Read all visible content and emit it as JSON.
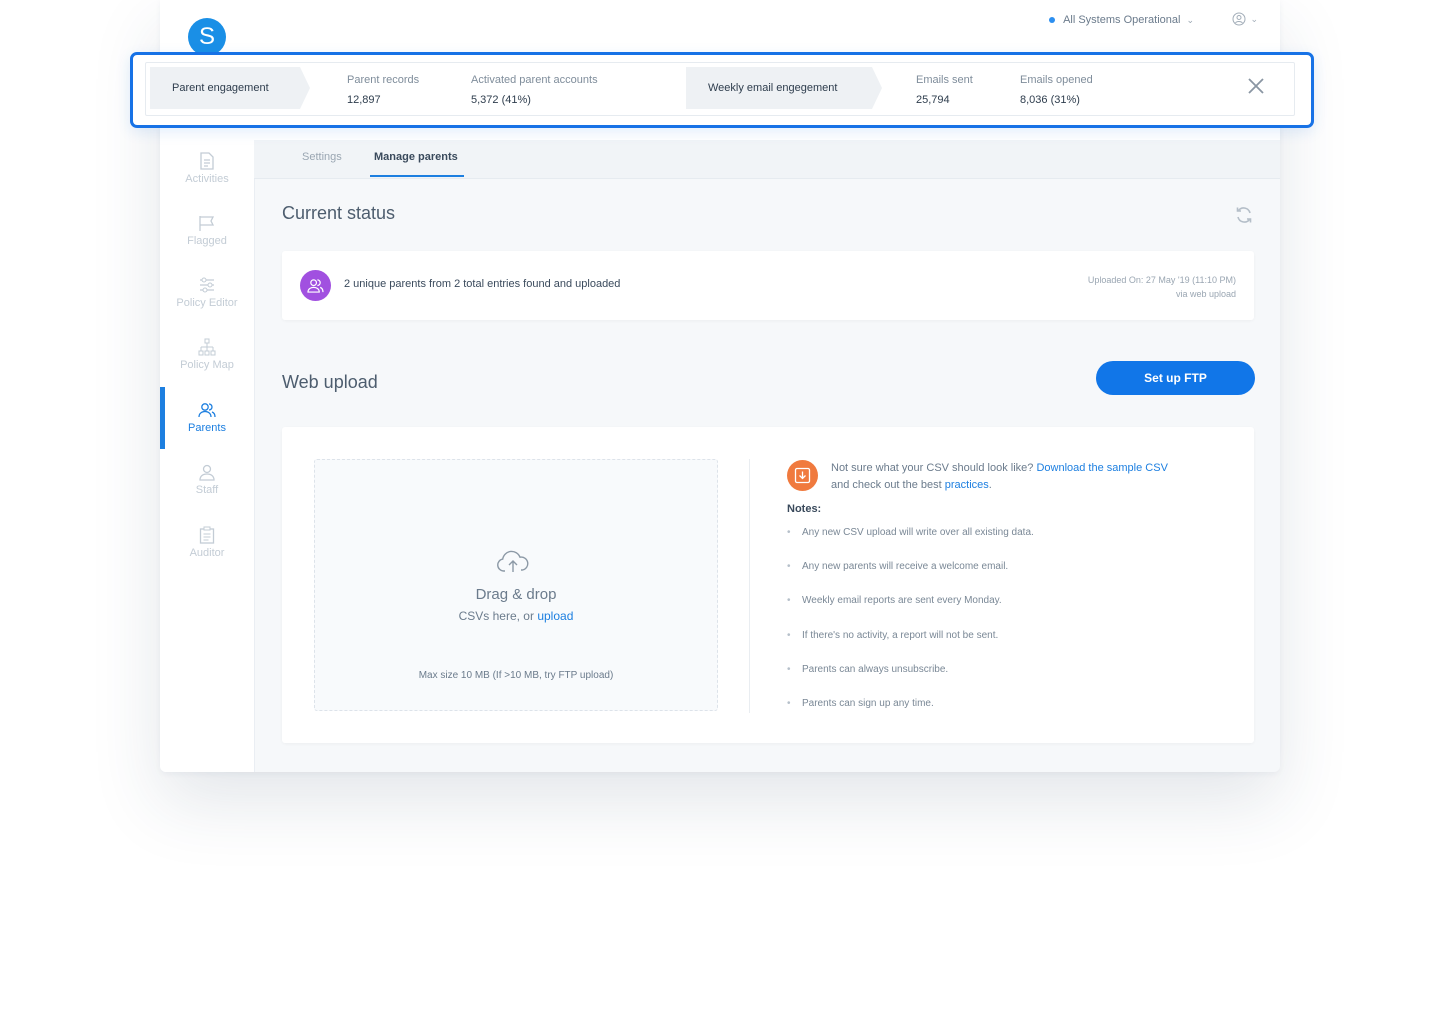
{
  "app": {
    "logo_letter": "S",
    "status": "All Systems Operational"
  },
  "sidebar": {
    "items": [
      {
        "label": "Activities",
        "icon": "document-icon"
      },
      {
        "label": "Flagged",
        "icon": "flag-icon"
      },
      {
        "label": "Policy Editor",
        "icon": "sliders-icon"
      },
      {
        "label": "Policy Map",
        "icon": "hierarchy-icon"
      },
      {
        "label": "Parents",
        "icon": "users-icon",
        "active": true
      },
      {
        "label": "Staff",
        "icon": "user-icon"
      },
      {
        "label": "Auditor",
        "icon": "clipboard-icon"
      }
    ]
  },
  "tabs": [
    {
      "label": "Settings"
    },
    {
      "label": "Manage parents",
      "active": true
    }
  ],
  "current_status": {
    "title": "Current status",
    "message": "2 unique parents from 2 total entries found and uploaded",
    "uploaded_on": "Uploaded On: 27 May '19 (11:10 PM)",
    "via": "via web upload"
  },
  "web_upload": {
    "title": "Web upload",
    "ftp_button": "Set up FTP",
    "drop_title": "Drag & drop",
    "drop_sub_prefix": "CSVs here, or",
    "drop_sub_link": "upload",
    "max_size": "Max size 10 MB (If >10 MB, try FTP upload)",
    "hint_line1": "Not sure what your CSV should look like?",
    "hint_link1": "Download the sample CSV",
    "hint_line2": "and check out the best",
    "hint_link2": "practices",
    "hint_end": ".",
    "notes_label": "Notes:",
    "notes": [
      "Any new CSV upload will write over all existing data.",
      "Any new parents will receive a welcome email.",
      "Weekly email reports are sent every Monday.",
      "If there's no activity, a report will not be sent.",
      "Parents can always unsubscribe.",
      "Parents can sign up any time."
    ]
  },
  "engagement_bar": {
    "parent_label": "Parent engagement",
    "parent_records_label": "Parent records",
    "parent_records_value": "12,897",
    "activated_label": "Activated parent accounts",
    "activated_value": "5,372 (41%)",
    "weekly_label": "Weekly email engegement",
    "emails_sent_label": "Emails sent",
    "emails_sent_value": "25,794",
    "emails_opened_label": "Emails opened",
    "emails_opened_value": "8,036 (31%)"
  },
  "colors": {
    "accent": "#1176e8",
    "highlight_border": "#1772e6",
    "parents_badge": "#a150e0",
    "download_badge": "#f07a3e"
  }
}
